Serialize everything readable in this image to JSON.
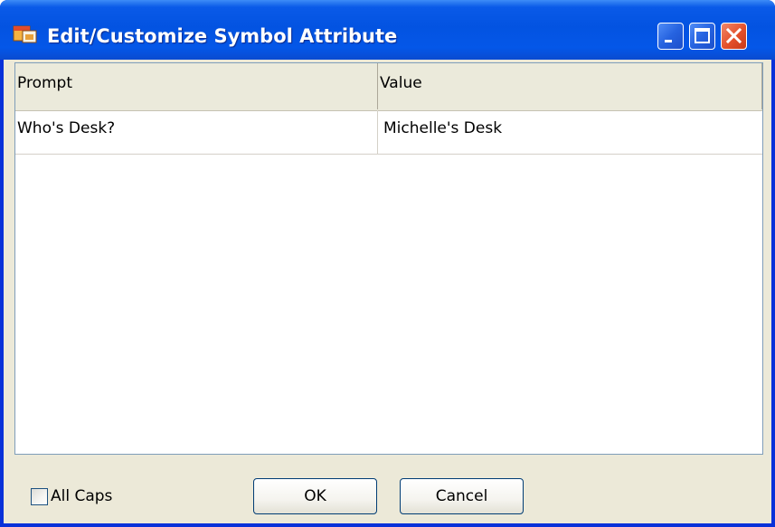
{
  "window": {
    "title": "Edit/Customize Symbol Attribute",
    "app_icon": "app-icon"
  },
  "titlebar_buttons": {
    "minimize": "minimize-icon",
    "maximize": "maximize-icon",
    "close": "close-icon"
  },
  "grid": {
    "columns": [
      "Prompt",
      "Value"
    ],
    "rows": [
      {
        "prompt": "Who's Desk?",
        "value": "Michelle's Desk"
      }
    ]
  },
  "footer": {
    "all_caps_label": "All Caps",
    "all_caps_checked": false,
    "ok_label": "OK",
    "cancel_label": "Cancel"
  },
  "colors": {
    "titlebar": "#0353e1",
    "dialog_face": "#ece9d8",
    "close_button": "#e4502a"
  }
}
